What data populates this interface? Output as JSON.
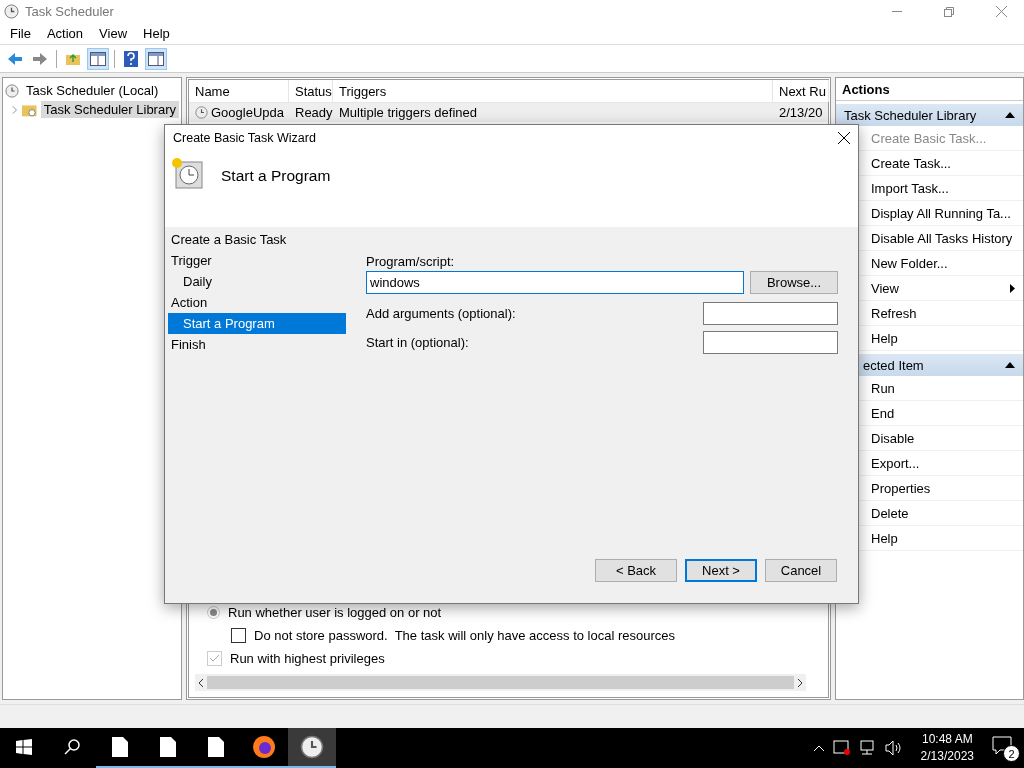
{
  "window": {
    "title": "Task Scheduler"
  },
  "menu": [
    "File",
    "Action",
    "View",
    "Help"
  ],
  "toolbar": [
    {
      "kind": "back",
      "pressed": false
    },
    {
      "kind": "forward",
      "pressed": false
    },
    {
      "kind": "up",
      "pressed": false
    },
    {
      "kind": "tree",
      "pressed": true
    },
    {
      "kind": "help",
      "pressed": false
    },
    {
      "kind": "pane",
      "pressed": true
    }
  ],
  "tree": [
    {
      "label": "Task Scheduler (Local)",
      "selected": false,
      "children": [
        {
          "label": "Task Scheduler Library",
          "selected": true,
          "expanded": false
        }
      ]
    }
  ],
  "task_list": {
    "columns": [
      "Name",
      "Status",
      "Triggers",
      "Next Ru"
    ],
    "rows": [
      {
        "cells": [
          "GoogleUpda",
          "Ready",
          "Multiple triggers defined",
          "2/13/20"
        ]
      }
    ]
  },
  "details": {
    "options": [
      {
        "kind": "radio",
        "label": "Run whether user is logged on or not",
        "checked": true,
        "disabled": true,
        "children": [
          {
            "kind": "checkbox",
            "label": "Do not store password.  The task will only have access to local resources",
            "checked": false,
            "disabled": false
          }
        ]
      },
      {
        "kind": "checkbox",
        "label": "Run with highest privileges",
        "checked": true,
        "disabled": true
      }
    ]
  },
  "actions": {
    "title": "Actions",
    "sections": [
      {
        "title": "Task Scheduler Library",
        "expanded": true,
        "items": [
          {
            "label": "Create Basic Task...",
            "disabled": true,
            "submenu": false
          },
          {
            "label": "Create Task...",
            "disabled": false,
            "submenu": false
          },
          {
            "label": "Import Task...",
            "disabled": false,
            "submenu": false
          },
          {
            "label": "Display All Running Ta...",
            "disabled": false,
            "submenu": false
          },
          {
            "label": "Disable All Tasks History",
            "disabled": false,
            "submenu": false
          },
          {
            "label": "New Folder...",
            "disabled": false,
            "submenu": false
          },
          {
            "label": "View",
            "disabled": false,
            "submenu": true
          },
          {
            "label": "Refresh",
            "disabled": false,
            "submenu": false
          },
          {
            "label": "Help",
            "disabled": false,
            "submenu": false
          }
        ]
      },
      {
        "title": "ected Item",
        "expanded": true,
        "items": [
          {
            "label": "Run",
            "disabled": false,
            "submenu": false
          },
          {
            "label": "End",
            "disabled": false,
            "submenu": false
          },
          {
            "label": "Disable",
            "disabled": false,
            "submenu": false
          },
          {
            "label": "Export...",
            "disabled": false,
            "submenu": false
          },
          {
            "label": "Properties",
            "disabled": false,
            "submenu": false
          },
          {
            "label": "Delete",
            "disabled": false,
            "submenu": false
          },
          {
            "label": "Help",
            "disabled": false,
            "submenu": false
          }
        ]
      }
    ]
  },
  "dialog": {
    "title": "Create Basic Task Wizard",
    "heading": "Start a Program",
    "steps": [
      {
        "label": "Create a Basic Task",
        "selected": false
      },
      {
        "label": "Trigger",
        "selected": false,
        "children": [
          {
            "label": "Daily",
            "selected": false
          }
        ]
      },
      {
        "label": "Action",
        "selected": false,
        "children": [
          {
            "label": "Start a Program",
            "selected": true
          }
        ]
      },
      {
        "label": "Finish",
        "selected": false
      }
    ],
    "fields": [
      {
        "kind": "wide",
        "label": "Program/script:",
        "value": "windows",
        "focused": true,
        "button": "Browse..."
      },
      {
        "kind": "short",
        "label": "Add arguments (optional):",
        "focused": false
      },
      {
        "kind": "short",
        "label": "Start in (optional):",
        "focused": false
      }
    ],
    "buttons": [
      {
        "label": "< Back",
        "default": false
      },
      {
        "label": "Next >",
        "default": true
      },
      {
        "label": "Cancel",
        "default": false
      }
    ]
  },
  "taskbar": {
    "apps": [
      {
        "kind": "document",
        "active": false
      },
      {
        "kind": "document",
        "active": false
      },
      {
        "kind": "document",
        "active": false
      },
      {
        "kind": "browser",
        "active": false
      },
      {
        "kind": "clock",
        "active": true
      }
    ],
    "time": "10:48 AM",
    "date": "2/13/2023",
    "notifications": "2"
  }
}
